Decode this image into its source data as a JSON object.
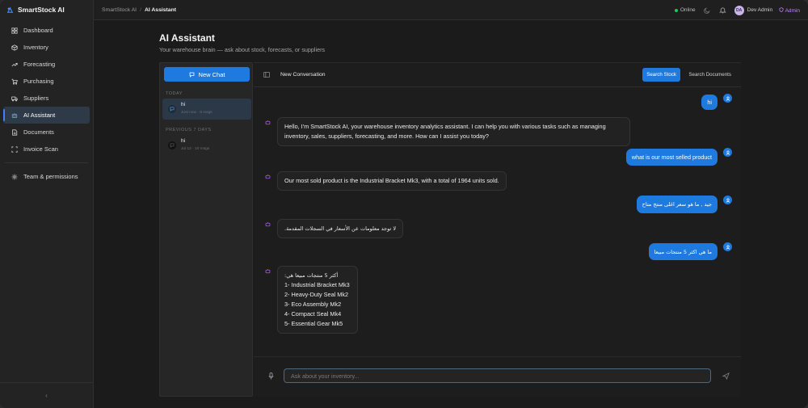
{
  "app": {
    "name": "SmartStock AI",
    "accent": "#1f7ae0",
    "collapse_glyph": "‹"
  },
  "sidebar": {
    "items": [
      {
        "label": "Dashboard",
        "icon": "grid-icon"
      },
      {
        "label": "Inventory",
        "icon": "box-icon"
      },
      {
        "label": "Forecasting",
        "icon": "trend-icon"
      },
      {
        "label": "Purchasing",
        "icon": "cart-icon"
      },
      {
        "label": "Suppliers",
        "icon": "truck-icon"
      },
      {
        "label": "AI Assistant",
        "icon": "bot-icon",
        "active": true
      },
      {
        "label": "Documents",
        "icon": "document-icon"
      },
      {
        "label": "Invoice Scan",
        "icon": "scan-icon"
      },
      {
        "label": "Team & permissions",
        "icon": "gear-icon"
      }
    ]
  },
  "topbar": {
    "breadcrumb_root": "SmartStock AI",
    "breadcrumb_sep": "/",
    "breadcrumb_current": "AI Assistant",
    "status": "Online",
    "user_name": "Dev Admin",
    "user_initials": "DA",
    "role": "Admin"
  },
  "page": {
    "title": "AI Assistant",
    "subtitle": "Your warehouse brain — ask about stock, forecasts, or suppliers"
  },
  "conversations": {
    "new_chat_label": "New Chat",
    "today_label": "TODAY",
    "previous_label": "PREVIOUS 7 DAYS",
    "today": [
      {
        "title": "hi",
        "meta": "Just now · 8 msgs"
      }
    ],
    "previous": [
      {
        "title": "hi",
        "meta": "Jul 12 · 10 msgs"
      }
    ]
  },
  "chat": {
    "title": "New Conversation",
    "search_stock_label": "Search Stock",
    "search_docs_label": "Search Documents",
    "input_placeholder": "Ask about your inventory...",
    "messages": [
      {
        "role": "user",
        "text": "hi"
      },
      {
        "role": "assistant",
        "text": "Hello, I'm SmartStock AI, your warehouse inventory analytics assistant. I can help you with various tasks such as managing inventory, sales, suppliers, forecasting, and more. How can I assist you today?"
      },
      {
        "role": "user",
        "text": "what is our most selled product"
      },
      {
        "role": "assistant",
        "text": "Our most sold product is the Industrial Bracket Mk3, with a total of 1964 units sold."
      },
      {
        "role": "user",
        "text": "جيد , ما هو سعر اغلى منتج متاح"
      },
      {
        "role": "assistant",
        "text": "لا توجد معلومات عن الأسعار في السجلات المقدمة."
      },
      {
        "role": "user",
        "text": "ما هي اكثر 5 منتجات مبيعا"
      },
      {
        "role": "assistant",
        "heading": "أكثر 5 منتجات مبيعا هي:",
        "list": [
          "1- Industrial Bracket Mk3",
          "2- Heavy-Duty Seal Mk2",
          "3- Eco Assembly Mk2",
          "4- Compact Seal Mk4",
          "5- Essential Gear Mk5"
        ]
      }
    ]
  }
}
